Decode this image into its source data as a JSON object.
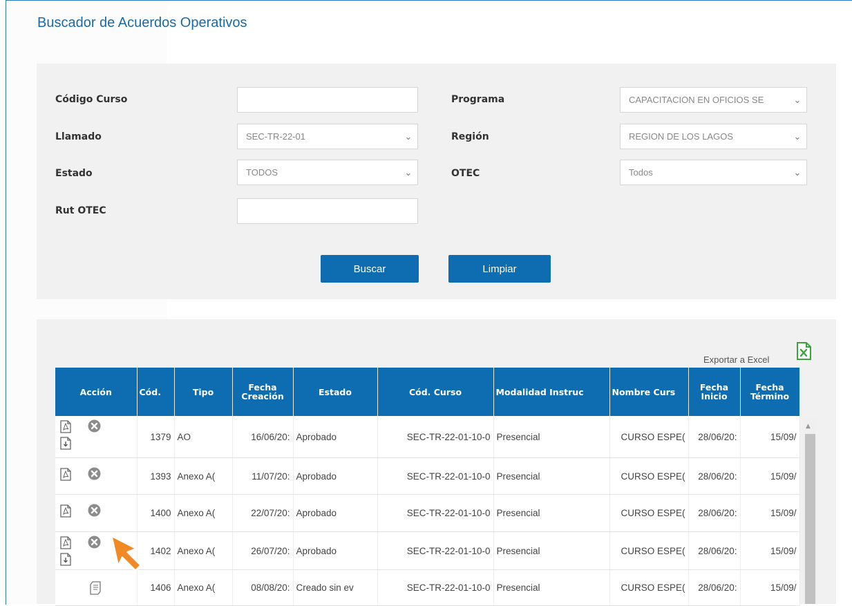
{
  "page": {
    "title": "Buscador de Acuerdos Operativos"
  },
  "filters": {
    "codigo_curso": {
      "label": "Código Curso",
      "value": ""
    },
    "llamado": {
      "label": "Llamado",
      "value": "SEC-TR-22-01"
    },
    "estado": {
      "label": "Estado",
      "value": "TODOS"
    },
    "rut_otec": {
      "label": "Rut OTEC",
      "value": ""
    },
    "programa": {
      "label": "Programa",
      "value": "CAPACITACION EN OFICIOS SE"
    },
    "region": {
      "label": "Región",
      "value": "REGION DE LOS LAGOS"
    },
    "otec": {
      "label": "OTEC",
      "value": "Todos"
    }
  },
  "buttons": {
    "buscar": "Buscar",
    "limpiar": "Limpiar"
  },
  "export": {
    "label": "Exportar a Excel",
    "icon": "excel-icon"
  },
  "table": {
    "columns": [
      "Acción",
      "Cód.",
      "Tipo",
      "Fecha Creación",
      "Estado",
      "Cód. Curso",
      "Modalidad Instruc",
      "Nombre Curs",
      "Fecha Inicio",
      "Fecha Término"
    ],
    "rows": [
      {
        "actions": [
          "pdf-icon",
          "cancel-icon",
          "pdf-download-icon"
        ],
        "cod": "1379",
        "tipo": "AO",
        "fecha_creacion": "16/06/20:",
        "estado": "Aprobado",
        "cod_curso": "SEC-TR-22-01-10-0",
        "modalidad": "Presencial",
        "nombre_curso": "CURSO ESPE(",
        "fecha_inicio": "28/06/20:",
        "fecha_termino": "15/09/"
      },
      {
        "actions": [
          "pdf-icon",
          "cancel-icon"
        ],
        "cod": "1393",
        "tipo": "Anexo A(",
        "fecha_creacion": "11/07/20:",
        "estado": "Aprobado",
        "cod_curso": "SEC-TR-22-01-10-0",
        "modalidad": "Presencial",
        "nombre_curso": "CURSO ESPE(",
        "fecha_inicio": "28/06/20:",
        "fecha_termino": "15/09/"
      },
      {
        "actions": [
          "pdf-icon",
          "cancel-icon"
        ],
        "cod": "1400",
        "tipo": "Anexo A(",
        "fecha_creacion": "22/07/20:",
        "estado": "Aprobado",
        "cod_curso": "SEC-TR-22-01-10-0",
        "modalidad": "Presencial",
        "nombre_curso": "CURSO ESPE(",
        "fecha_inicio": "28/06/20:",
        "fecha_termino": "15/09/"
      },
      {
        "actions": [
          "pdf-icon",
          "cancel-icon",
          "pdf-download-icon"
        ],
        "cod": "1402",
        "tipo": "Anexo A(",
        "fecha_creacion": "26/07/20:",
        "estado": "Aprobado",
        "cod_curso": "SEC-TR-22-01-10-0",
        "modalidad": "Presencial",
        "nombre_curso": "CURSO ESPE(",
        "fecha_inicio": "28/06/20:",
        "fecha_termino": "15/09/"
      },
      {
        "actions": [
          "document-icon"
        ],
        "cod": "1406",
        "tipo": "Anexo A(",
        "fecha_creacion": "08/08/20:",
        "estado": "Creado sin ev",
        "cod_curso": "SEC-TR-22-01-10-0",
        "modalidad": "Presencial",
        "nombre_curso": "CURSO ESPE(",
        "fecha_inicio": "28/06/20:",
        "fecha_termino": "15/09/"
      }
    ]
  },
  "colors": {
    "accent": "#0e6db0",
    "title": "#1a6aa8",
    "cursor": "#f08a24",
    "excel": "#3aa53a"
  }
}
